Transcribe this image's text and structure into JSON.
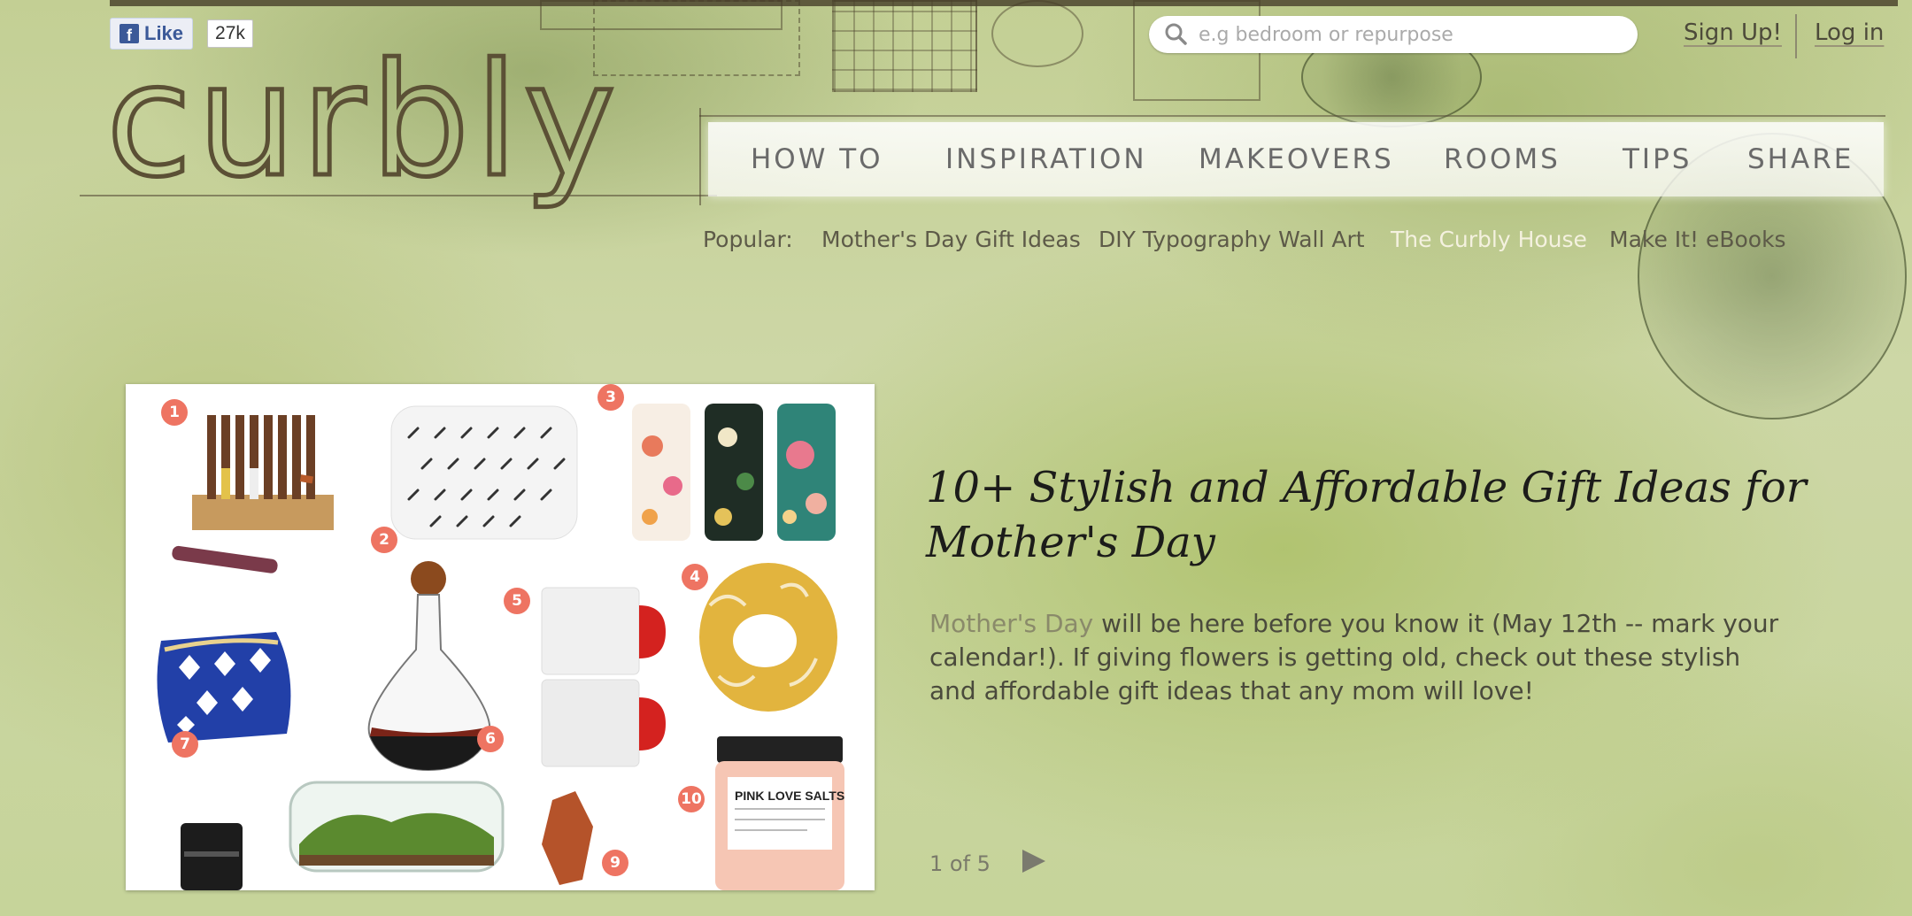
{
  "facebook": {
    "like_label": "Like",
    "like_count": "27k",
    "fb_glyph": "f"
  },
  "site": {
    "logo_text": "curbly"
  },
  "search": {
    "placeholder": "e.g bedroom or repurpose"
  },
  "auth": {
    "signup_label": "Sign Up!",
    "login_label": "Log in"
  },
  "nav": {
    "items": [
      {
        "label": "HOW TO"
      },
      {
        "label": "INSPIRATION"
      },
      {
        "label": "MAKEOVERS"
      },
      {
        "label": "ROOMS"
      },
      {
        "label": "TIPS"
      },
      {
        "label": "SHARE"
      }
    ]
  },
  "popular": {
    "label": "Popular:",
    "links": [
      {
        "label": "Mother's Day Gift Ideas"
      },
      {
        "label": "DIY Typography Wall Art"
      },
      {
        "label": "The Curbly House"
      },
      {
        "label": "Make It! eBooks"
      }
    ]
  },
  "feature": {
    "numbers": [
      "1",
      "2",
      "3",
      "4",
      "5",
      "6",
      "7",
      "9",
      "10"
    ],
    "product_label": "PINK LOVE SALTS",
    "headline": "10+ Stylish and Affordable Gift Ideas for Mother's Day",
    "description_link": "Mother's Day",
    "description_rest": " will be here before you know it (May 12th -- mark your calendar!). If giving flowers is getting old, check out these stylish and affordable gift ideas that any mom will love!",
    "pager": "1 of 5"
  },
  "colors": {
    "accent": "#ee7462",
    "nav_text": "#6a6a6a",
    "active_popular": "#f4f1df"
  }
}
